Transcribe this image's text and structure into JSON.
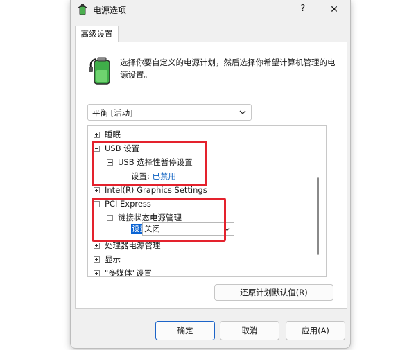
{
  "window": {
    "title": "电源选项",
    "help": "?",
    "close": "✕"
  },
  "tab": {
    "label": "高级设置"
  },
  "description": "选择你要自定义的电源计划，然后选择你希望计算机管理的电源设置。",
  "plan_select": {
    "value": "平衡 [活动]"
  },
  "tree": {
    "sleep": "睡眠",
    "usb": "USB 设置",
    "usb_selective": "USB 选择性暂停设置",
    "usb_setting_label": "设置:",
    "usb_setting_value": "已禁用",
    "intel_graphics": "Intel(R) Graphics Settings",
    "pci": "PCI Express",
    "link_state": "链接状态电源管理",
    "link_setting_label": "设置:",
    "link_setting_value": "关闭",
    "processor": "处理器电源管理",
    "display": "显示",
    "multimedia": "\"多媒体\"设置"
  },
  "buttons": {
    "restore": "还原计划默认值(R)",
    "ok": "确定",
    "cancel": "取消",
    "apply": "应用(A)"
  },
  "colors": {
    "highlight": "#e4222d",
    "link": "#0a5fc0",
    "selection": "#0a64d4"
  }
}
